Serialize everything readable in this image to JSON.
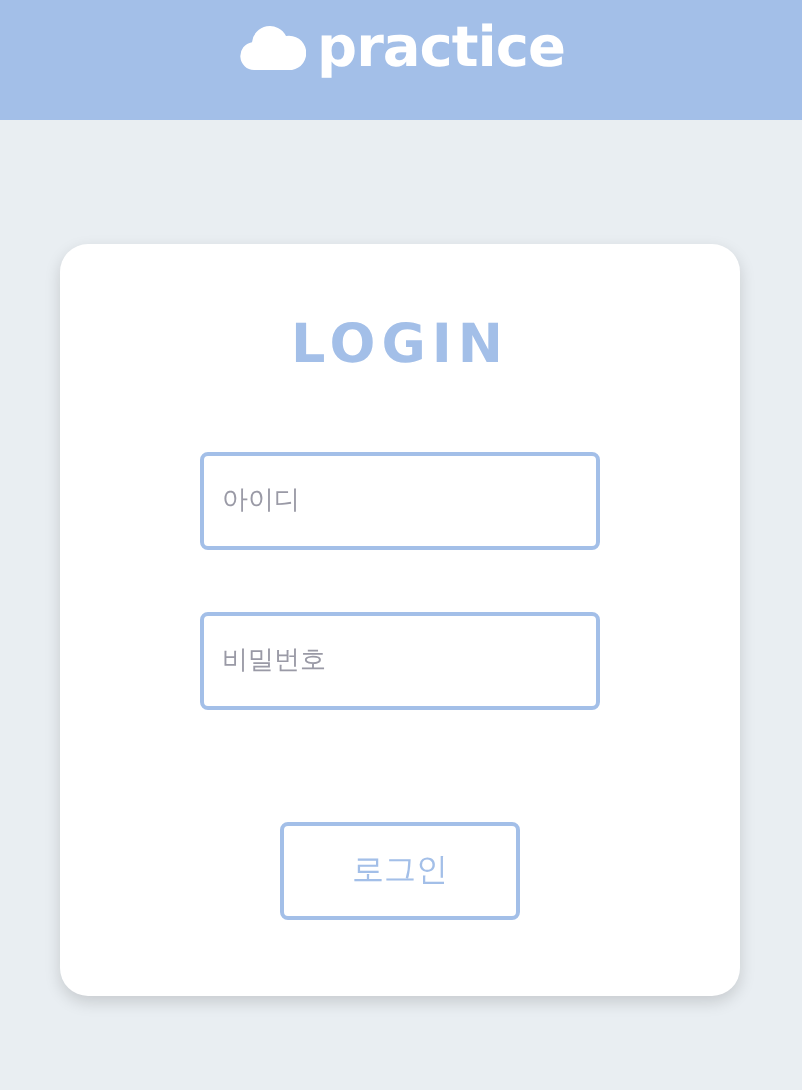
{
  "header": {
    "title": "practice"
  },
  "login": {
    "heading": "LOGIN",
    "fields": [
      {
        "placeholder": "아이디"
      },
      {
        "placeholder": "비밀번호"
      }
    ],
    "button": "로그인"
  }
}
